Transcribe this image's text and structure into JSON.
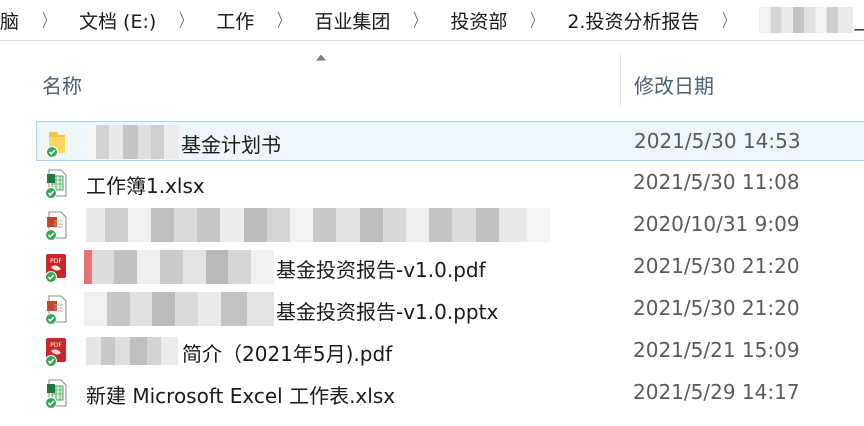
{
  "breadcrumb": {
    "items": [
      "脑",
      "文档 (E:)",
      "工作",
      "百业集团",
      "投资部",
      "2.投资分析报告"
    ],
    "tail": "_"
  },
  "columns": {
    "name": "名称",
    "date_modified": "修改日期"
  },
  "files": [
    {
      "name": "基金计划书",
      "date": "2021/5/30 14:53",
      "icon": "folder-icon",
      "selected": true
    },
    {
      "name": "工作簿1.xlsx",
      "date": "2021/5/30 11:08",
      "icon": "excel-file-icon"
    },
    {
      "name": "",
      "date": "2020/10/31 9:09",
      "icon": "generic-doc-icon"
    },
    {
      "name": "基金投资报告-v1.0.pdf",
      "date": "2021/5/30 21:20",
      "icon": "pdf-file-icon"
    },
    {
      "name": "基金投资报告-v1.0.pptx",
      "date": "2021/5/30 21:20",
      "icon": "generic-doc-icon"
    },
    {
      "name": "简介（2021年5月).pdf",
      "date": "2021/5/21 15:09",
      "icon": "pdf-file-icon"
    },
    {
      "name": "新建 Microsoft Excel 工作表.xlsx",
      "date": "2021/5/29 14:17",
      "icon": "excel-file-icon"
    }
  ],
  "colors": {
    "selection_bg": "#eef6fb",
    "selection_border": "#a9d7f1",
    "sync_check": "#34a853",
    "header_text": "#4a5f7a"
  }
}
